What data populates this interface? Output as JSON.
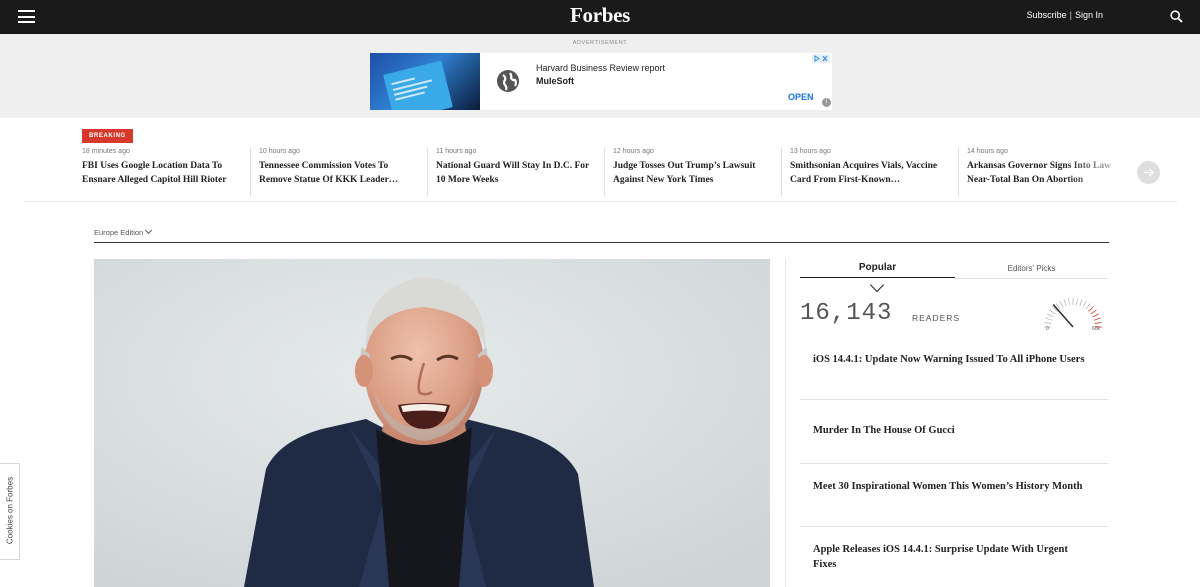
{
  "header": {
    "logo": "Forbes",
    "subscribe_label": "Subscribe",
    "separator": "|",
    "signin_label": "Sign In"
  },
  "ad": {
    "label": "ADVERTISEMENT",
    "title": "Harvard Business Review report",
    "brand": "MuleSoft",
    "cta": "OPEN"
  },
  "breaking": {
    "badge": "BREAKING",
    "items": [
      {
        "time": "18 minutes ago",
        "headline": "FBI Uses Google Location Data To Ensnare Alleged Capitol Hill Rioter"
      },
      {
        "time": "10 hours ago",
        "headline": "Tennessee Commission Votes To Remove Statue Of KKK Leader…"
      },
      {
        "time": "11 hours ago",
        "headline": "National Guard Will Stay In D.C. For 10 More Weeks"
      },
      {
        "time": "12 hours ago",
        "headline": "Judge Tosses Out Trump’s Lawsuit Against New York Times"
      },
      {
        "time": "13 hours ago",
        "headline": "Smithsonian Acquires Vials, Vaccine Card From First-Known…"
      },
      {
        "time": "14 hours ago",
        "headline": "Arkansas Governor Signs Into Law Near-Total Ban On Abortion"
      }
    ]
  },
  "edition": {
    "label": "Europe Edition"
  },
  "sidebar": {
    "tabs": [
      {
        "label": "Popular"
      },
      {
        "label": "Editors' Picks"
      }
    ],
    "readers_count": "16,143",
    "readers_label": "READERS",
    "gauge_min": "0",
    "gauge_max": "60k",
    "gauge_value_fraction": 0.27,
    "articles": [
      {
        "title": "iOS 14.4.1: Update Now Warning Issued To All iPhone Users"
      },
      {
        "title": "Murder In The House Of Gucci"
      },
      {
        "title": "Meet 30 Inspirational Women This Women’s History Month"
      },
      {
        "title": "Apple Releases iOS 14.4.1: Surprise Update With Urgent Fixes"
      }
    ]
  },
  "cookies": {
    "label": "Cookies on Forbes"
  },
  "colors": {
    "topbar": "#1a1a1a",
    "breaking_badge": "#d6392b",
    "ad_cta": "#1a73e8"
  }
}
